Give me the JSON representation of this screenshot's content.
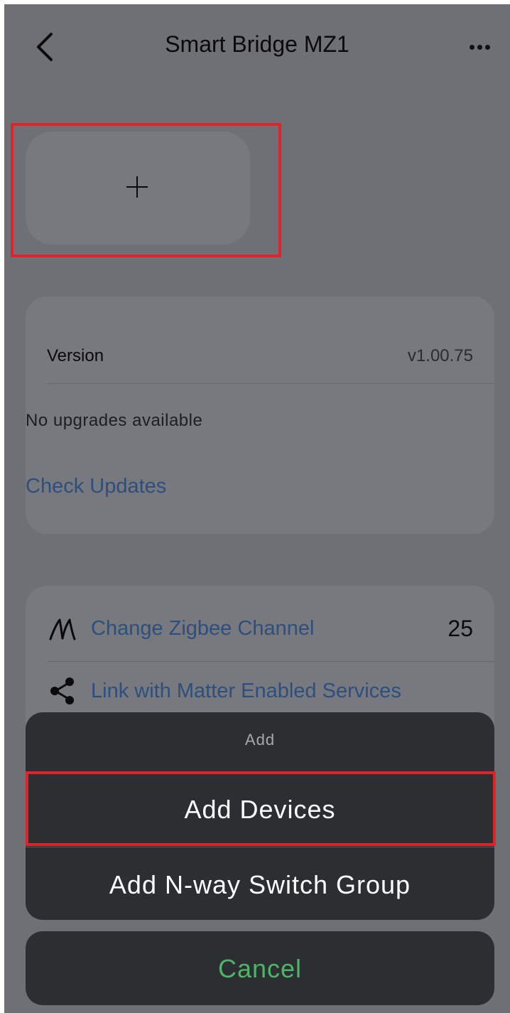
{
  "header": {
    "title": "Smart Bridge MZ1",
    "back_icon": "chevron-left-icon",
    "more_icon": "more-horizontal-icon"
  },
  "add_tile": {
    "icon": "plus-icon"
  },
  "firmware": {
    "version_label": "Version",
    "version_value": "v1.00.75",
    "upgrade_status": "No upgrades available",
    "check_updates_label": "Check Updates"
  },
  "settings": {
    "zigbee_label": "Change Zigbee Channel",
    "zigbee_channel": "25",
    "zigbee_icon": "zigbee-icon",
    "matter_label": "Link with Matter Enabled Services",
    "matter_icon": "share-icon"
  },
  "action_sheet": {
    "title": "Add",
    "options": [
      {
        "label": "Add Devices"
      },
      {
        "label": "Add N-way Switch Group"
      }
    ],
    "cancel_label": "Cancel"
  },
  "colors": {
    "overlay_background": "#6f7075",
    "card_background": "#78797e",
    "link_blue": "#2c4f7d",
    "sheet_background": "#2c2f32",
    "cancel_green": "#4fb468",
    "highlight_red": "#e02328"
  }
}
